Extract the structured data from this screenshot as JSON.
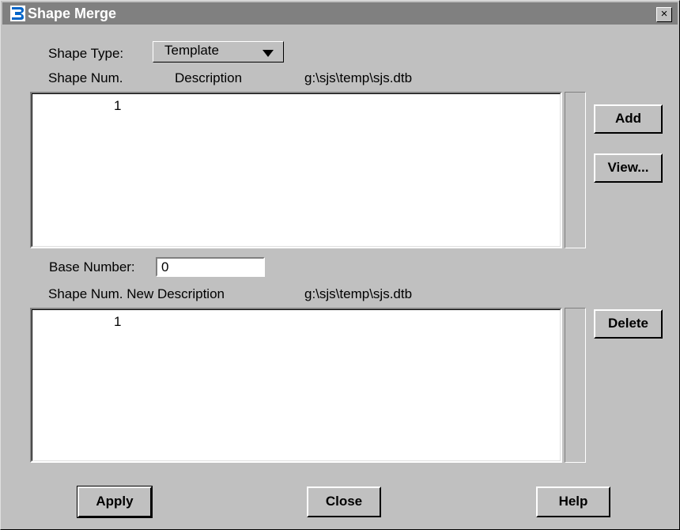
{
  "window": {
    "title": "Shape Merge",
    "close_glyph": "×"
  },
  "shape_type": {
    "label": "Shape Type:",
    "selected": "Template"
  },
  "top_list": {
    "headers": {
      "shape_num": "Shape Num.",
      "description": "Description",
      "file": "g:\\sjs\\temp\\sjs.dtb"
    },
    "rows": [
      "1"
    ]
  },
  "buttons": {
    "add": "Add",
    "view": "View...",
    "delete": "Delete",
    "apply": "Apply",
    "close": "Close",
    "help": "Help"
  },
  "base_number": {
    "label": "Base Number:",
    "value": "0"
  },
  "bottom_list": {
    "headers": {
      "shape_num_desc": "Shape Num. New Description",
      "file": "g:\\sjs\\temp\\sjs.dtb"
    },
    "rows": [
      "1"
    ]
  },
  "icons": {
    "app": "bentley-b-icon",
    "dropdown": "triangle-down-icon"
  },
  "colors": {
    "titlebar": "#808080",
    "window_bg": "#c0c0c0",
    "app_icon": "#0064c8"
  }
}
